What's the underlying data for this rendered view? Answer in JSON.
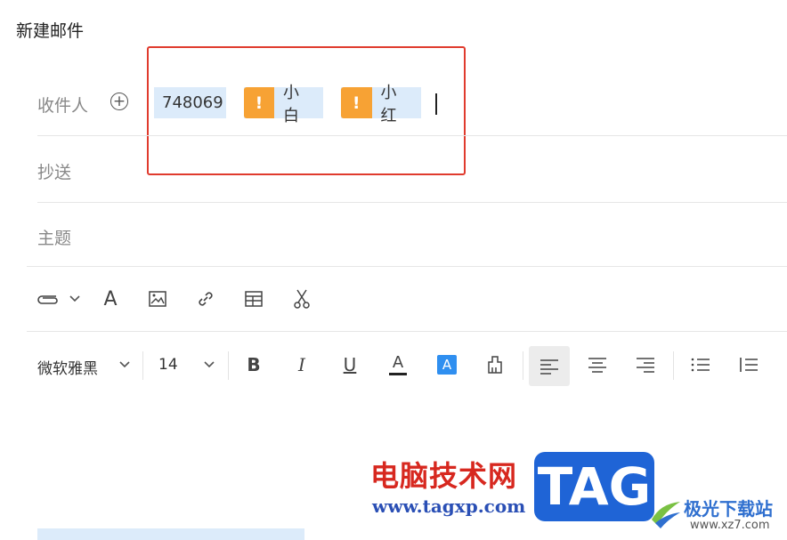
{
  "window": {
    "title": "新建邮件"
  },
  "fields": {
    "to_label": "收件人",
    "cc_label": "抄送",
    "subject_label": "主题"
  },
  "recipients": [
    {
      "text": "748069",
      "warning": false
    },
    {
      "text": "小白",
      "warning": true,
      "warn_symbol": "!"
    },
    {
      "text": "小红",
      "warning": true,
      "warn_symbol": "!"
    }
  ],
  "attach_toolbar": {
    "icons": [
      "paperclip-icon",
      "chevron-down-icon",
      "font-icon",
      "image-icon",
      "link-icon",
      "table-icon",
      "scissors-icon"
    ]
  },
  "format_toolbar": {
    "font_family": "微软雅黑",
    "font_size": "14",
    "bold": "B",
    "italic": "I",
    "underline": "U",
    "font_color": "A",
    "highlight": "A",
    "active_align": "left"
  },
  "watermark": {
    "cn_text": "电脑技术网",
    "url": "www.tagxp.com",
    "logo_text": "TAG",
    "site_name": "极光下载站",
    "site_url": "www.xz7.com"
  },
  "colors": {
    "warning": "#f7a234",
    "chip_bg": "#dcebfa",
    "highlight_border": "#e03b2e",
    "accent_blue": "#2f8ff0"
  }
}
